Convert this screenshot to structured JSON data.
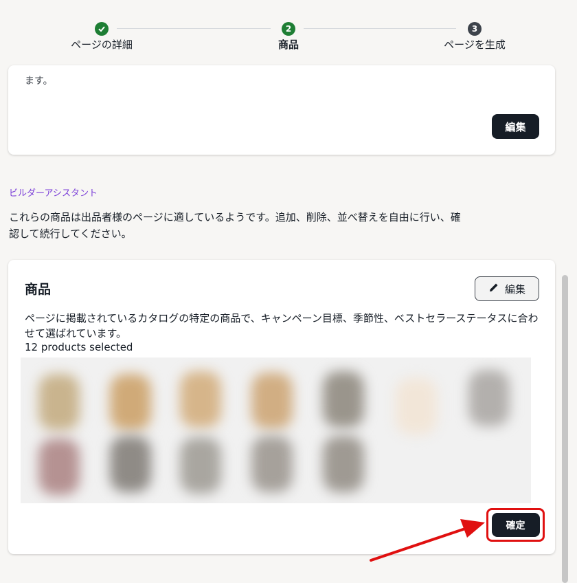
{
  "stepper": {
    "steps": [
      {
        "number": "1",
        "label": "ページの詳細",
        "state": "done"
      },
      {
        "number": "2",
        "label": "商品",
        "state": "current"
      },
      {
        "number": "3",
        "label": "ページを生成",
        "state": "pending"
      }
    ]
  },
  "details_card": {
    "text_tail": "ます。",
    "edit_label": "編集"
  },
  "assistant": {
    "label": "ビルダーアシスタント",
    "message": "これらの商品は出品者様のページに適しているようです。追加、削除、並べ替えを自由に行い、確認して続行してください。"
  },
  "products_card": {
    "title": "商品",
    "edit_label": "編集",
    "description": "ページに掲載されているカタログの特定の商品で、キャンペーン目標、季節性、ベストセラーステータスに合わせて選ばれています。",
    "count_text": "12 products selected",
    "confirm_label": "確定"
  },
  "colors": {
    "accent_purple": "#7b3fd8",
    "primary_button": "#161d26",
    "success_green": "#1e7e34",
    "highlight_red": "#e01010"
  }
}
